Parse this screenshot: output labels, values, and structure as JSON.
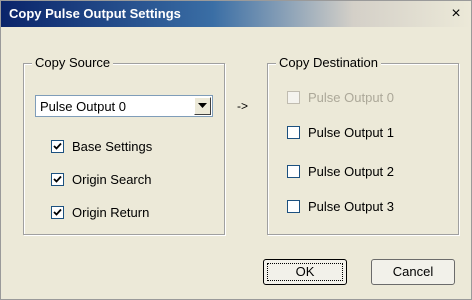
{
  "window": {
    "title": "Copy Pulse Output Settings",
    "close_glyph": "×"
  },
  "source": {
    "legend": "Copy Source",
    "select_value": "Pulse Output 0",
    "checkboxes": [
      {
        "label": "Base Settings",
        "checked": true
      },
      {
        "label": "Origin Search",
        "checked": true
      },
      {
        "label": "Origin Return",
        "checked": true
      }
    ]
  },
  "arrow": "->",
  "destination": {
    "legend": "Copy Destination",
    "checkboxes": [
      {
        "label": "Pulse Output 0",
        "checked": false,
        "disabled": true
      },
      {
        "label": "Pulse Output 1",
        "checked": false,
        "disabled": false
      },
      {
        "label": "Pulse Output 2",
        "checked": false,
        "disabled": false
      },
      {
        "label": "Pulse Output 3",
        "checked": false,
        "disabled": false
      }
    ]
  },
  "buttons": {
    "ok": "OK",
    "cancel": "Cancel"
  }
}
